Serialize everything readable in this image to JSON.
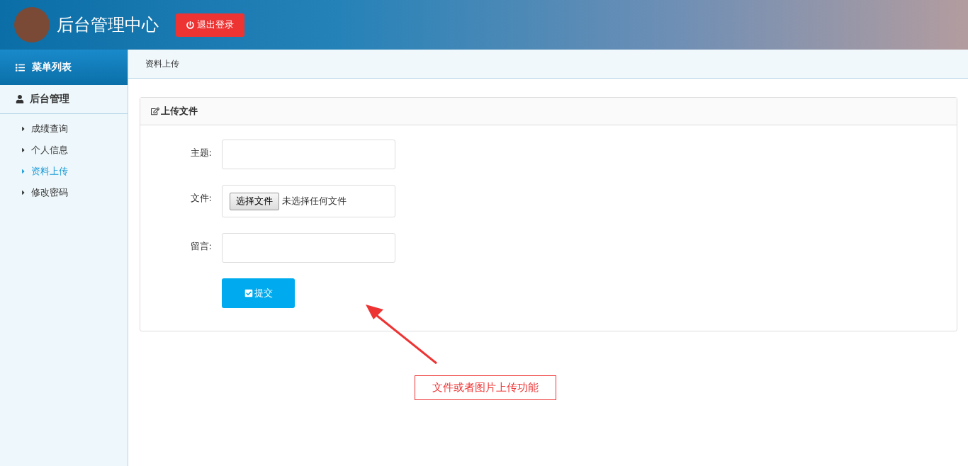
{
  "header": {
    "title": "后台管理中心",
    "logout_button": "退出登录"
  },
  "sidebar": {
    "heading": "菜单列表",
    "group": "后台管理",
    "items": [
      {
        "label": "成绩查询",
        "selected": false
      },
      {
        "label": "个人信息",
        "selected": false
      },
      {
        "label": "资料上传",
        "selected": true
      },
      {
        "label": "修改密码",
        "selected": false
      }
    ]
  },
  "breadcrumb": "资料上传",
  "panel": {
    "title": "上传文件",
    "fields": [
      {
        "kind": "text",
        "label": "主题:"
      },
      {
        "kind": "file",
        "label": "文件:",
        "button": "选择文件",
        "status": "未选择任何文件"
      },
      {
        "kind": "text",
        "label": "留言:"
      }
    ],
    "submit": "提交"
  },
  "annotation": "文件或者图片上传功能"
}
